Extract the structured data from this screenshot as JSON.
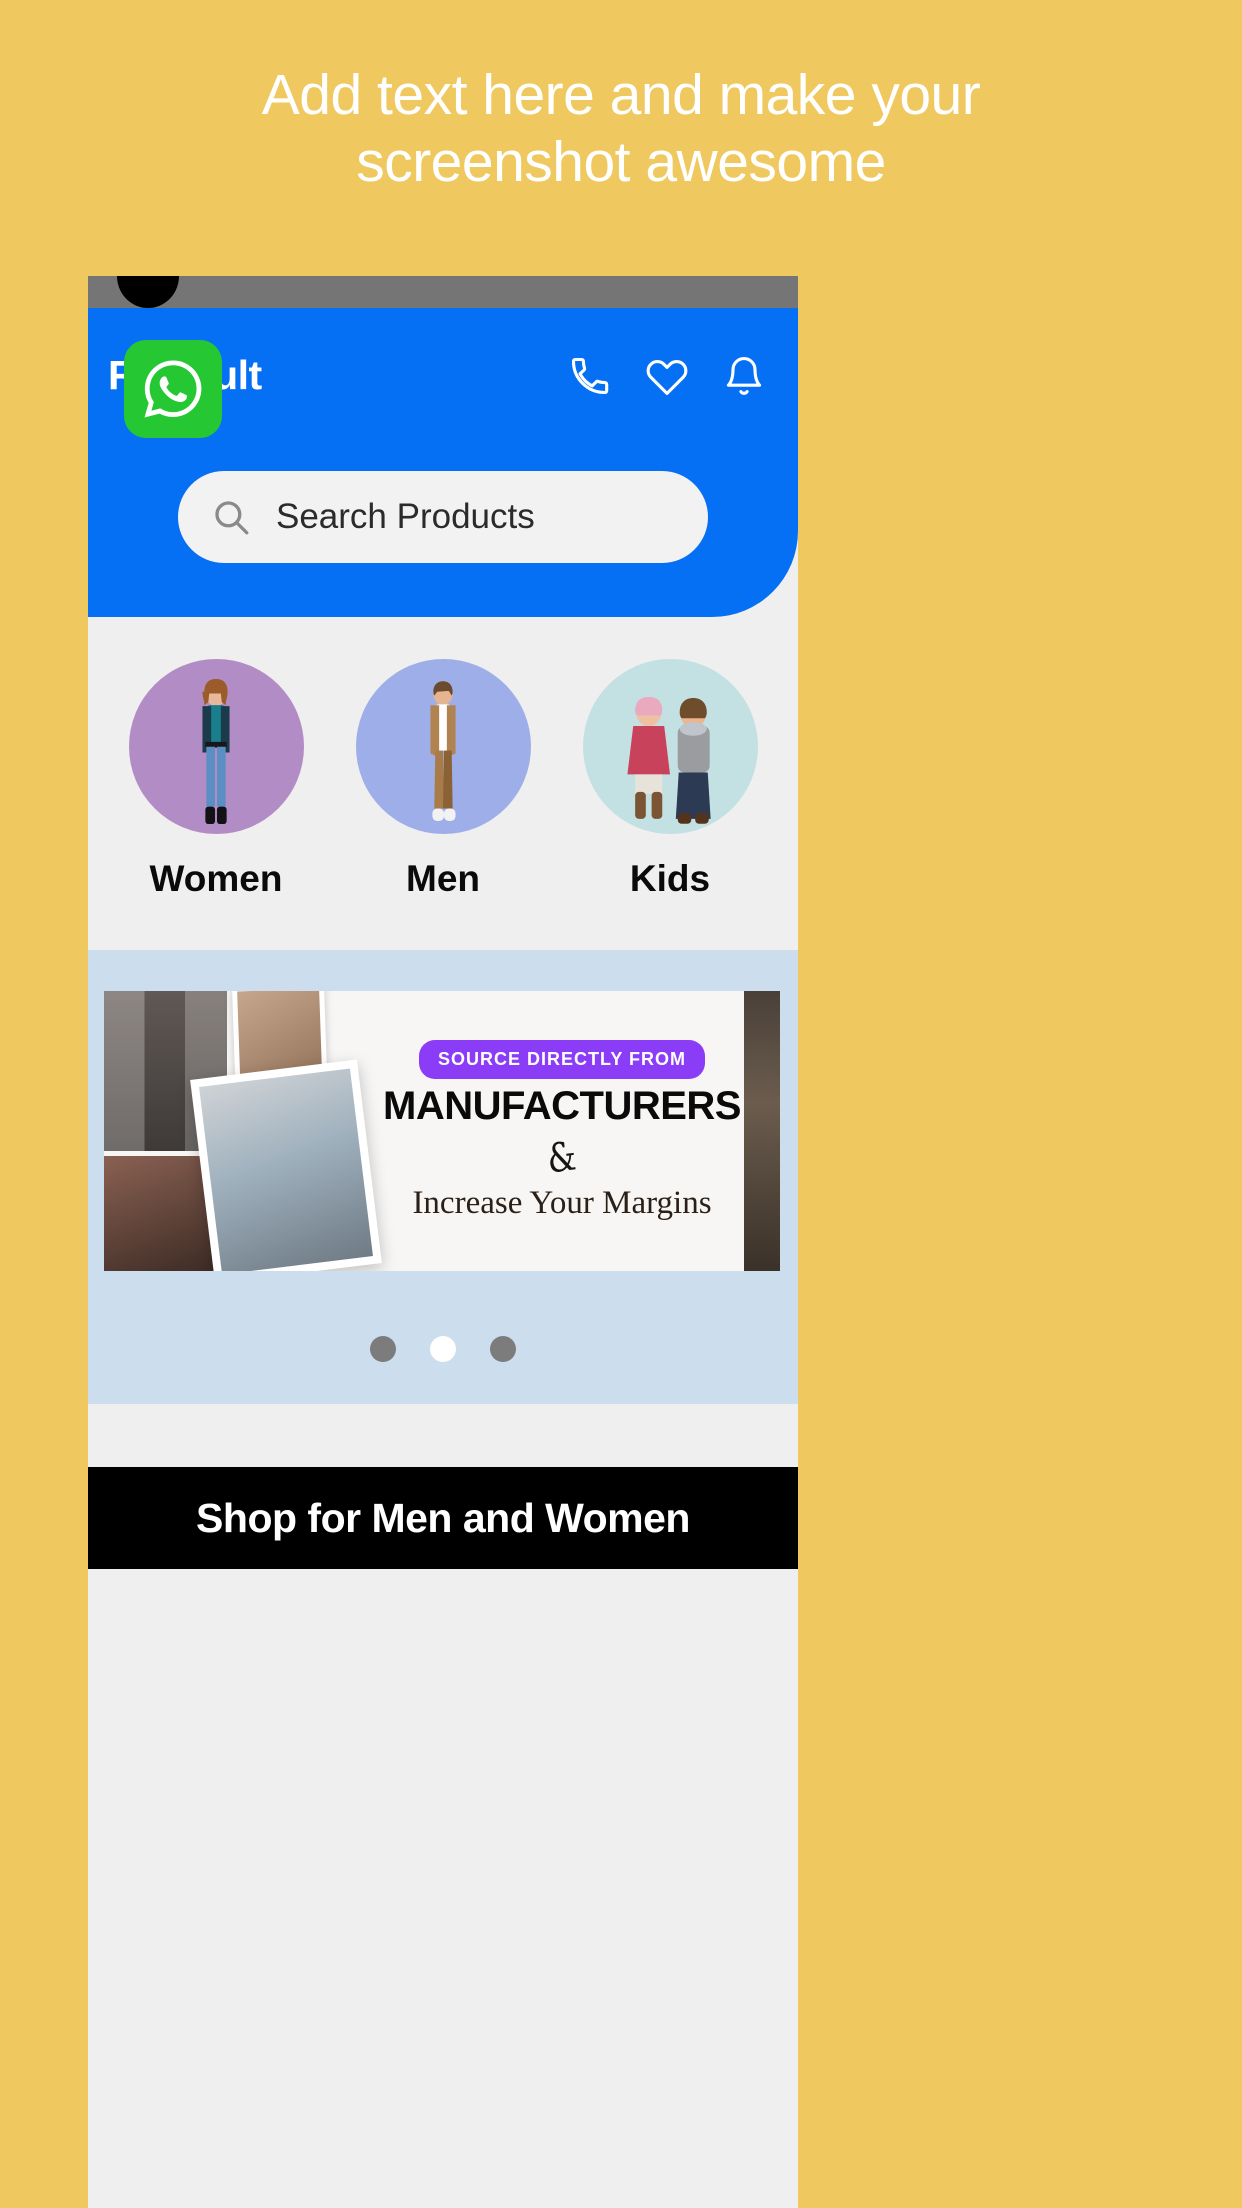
{
  "promo": {
    "line1": "Add text here and make your",
    "line2": "screenshot awesome"
  },
  "colors": {
    "page_background": "#EFC95F",
    "header_blue": "#0670F5",
    "status_bar": "#757575",
    "surface": "#EFEFEF",
    "banner_strip": "#CCDDEE",
    "badge_purple": "#8B3CF7",
    "whatsapp_green": "#25C833",
    "bottom_bar": "#000000"
  },
  "app": {
    "brand": "Rawcult",
    "header_icons": [
      {
        "name": "phone-icon",
        "label": "Call"
      },
      {
        "name": "heart-icon",
        "label": "Wishlist"
      },
      {
        "name": "bell-icon",
        "label": "Notifications"
      }
    ],
    "search": {
      "placeholder": "Search Products",
      "icon": "search-icon"
    },
    "categories": [
      {
        "label": "Women",
        "circle_color": "#B28CC5"
      },
      {
        "label": "Men",
        "circle_color": "#9EAEE8"
      },
      {
        "label": "Kids",
        "circle_color": "#C3E0E3"
      }
    ],
    "banner": {
      "badge": "SOURCE DIRECTLY FROM",
      "headline": "MANUFACTURERS",
      "flourish": "&",
      "subline": "Increase Your Margins",
      "carousel": {
        "total_dots": 3,
        "active_index": 1
      }
    },
    "bottom_bar": {
      "title": "Shop for Men and Women"
    },
    "fab": {
      "name": "whatsapp-icon",
      "label": "WhatsApp"
    }
  }
}
